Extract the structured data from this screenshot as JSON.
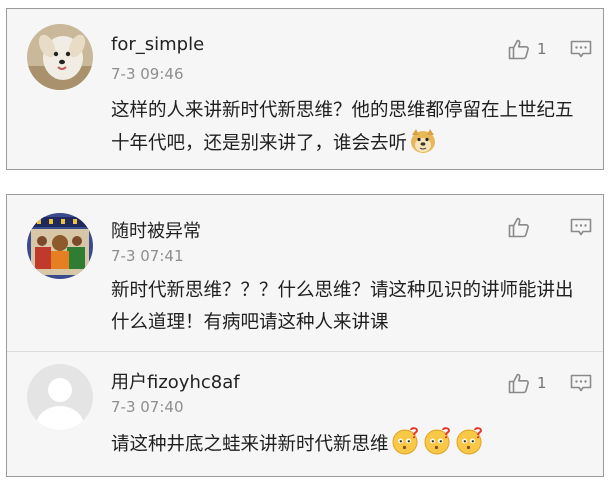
{
  "comments": [
    {
      "username": "for_simple",
      "timestamp": "7-3 09:46",
      "likes": "1",
      "text": "这样的人来讲新时代新思维？他的思维都停留在上世纪五十年代吧，还是别来讲了，谁会去听",
      "avatar": "dog-photo",
      "emoji": "doge"
    },
    {
      "username": "随时被异常",
      "timestamp": "7-3 07:41",
      "likes": "",
      "text": "新时代新思维？？？什么思维？请这种见识的讲师能讲出什么道理！有病吧请这种人来讲课",
      "avatar": "illustration-avatar"
    },
    {
      "username": "用户fizoyhc8af",
      "timestamp": "7-3 07:40",
      "likes": "1",
      "text": "请这种井底之蛙来讲新时代新思维",
      "avatar": "default-avatar",
      "emoji": "puzzled-face ×3"
    }
  ],
  "icons": {
    "like": "thumbs-up-icon",
    "reply": "comment-bubble-icon"
  },
  "colors": {
    "card_background": "#f6f6f6",
    "border": "#9a9a9a",
    "timestamp": "#8e8e8e"
  }
}
